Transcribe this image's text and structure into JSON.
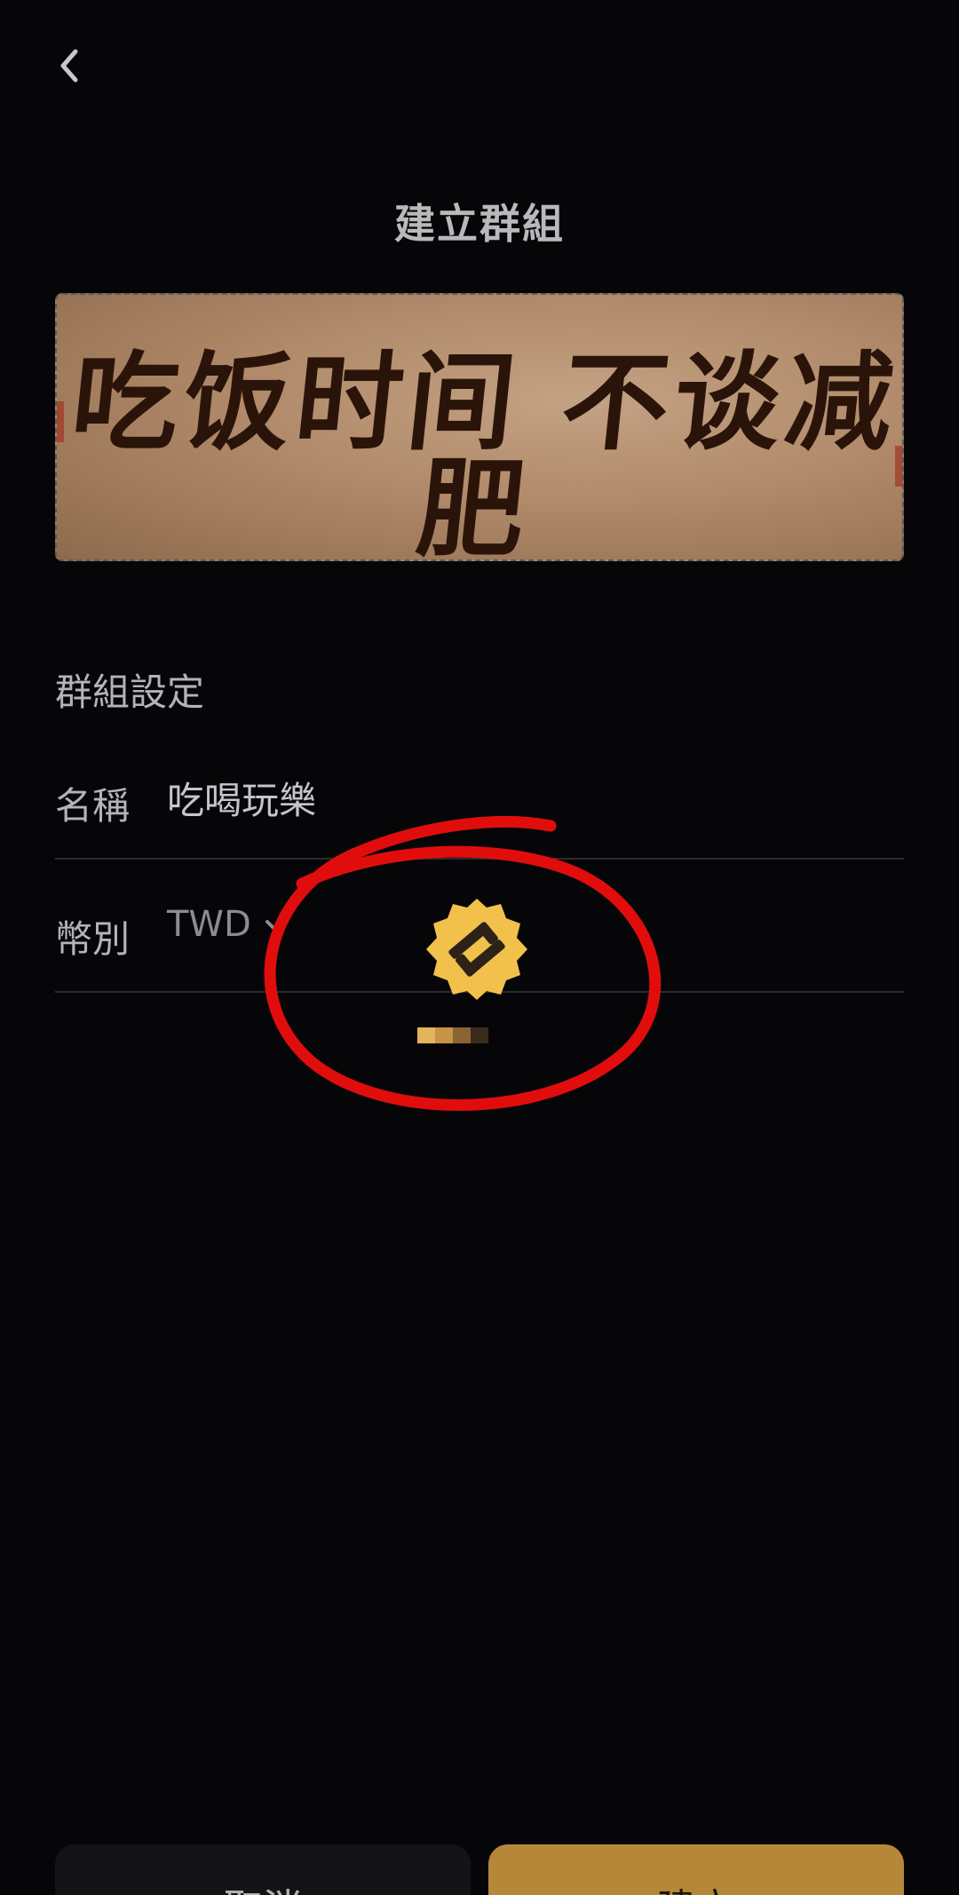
{
  "header": {
    "title": "建立群組",
    "back_icon": "chevron-left-icon"
  },
  "cover": {
    "text": "吃饭时间 不谈减肥"
  },
  "settings": {
    "section_title": "群組設定",
    "name_label": "名稱",
    "name_value": "吃喝玩樂",
    "currency_label": "幣別",
    "currency_value": "TWD",
    "currency_icon": "chevron-down-icon"
  },
  "actions": {
    "cancel_label": "取消",
    "create_label": "建立"
  },
  "colors": {
    "background": "#060609",
    "accent": "#b58839",
    "annotation_circle": "#e10d0d",
    "badge": "#f1c14c"
  }
}
